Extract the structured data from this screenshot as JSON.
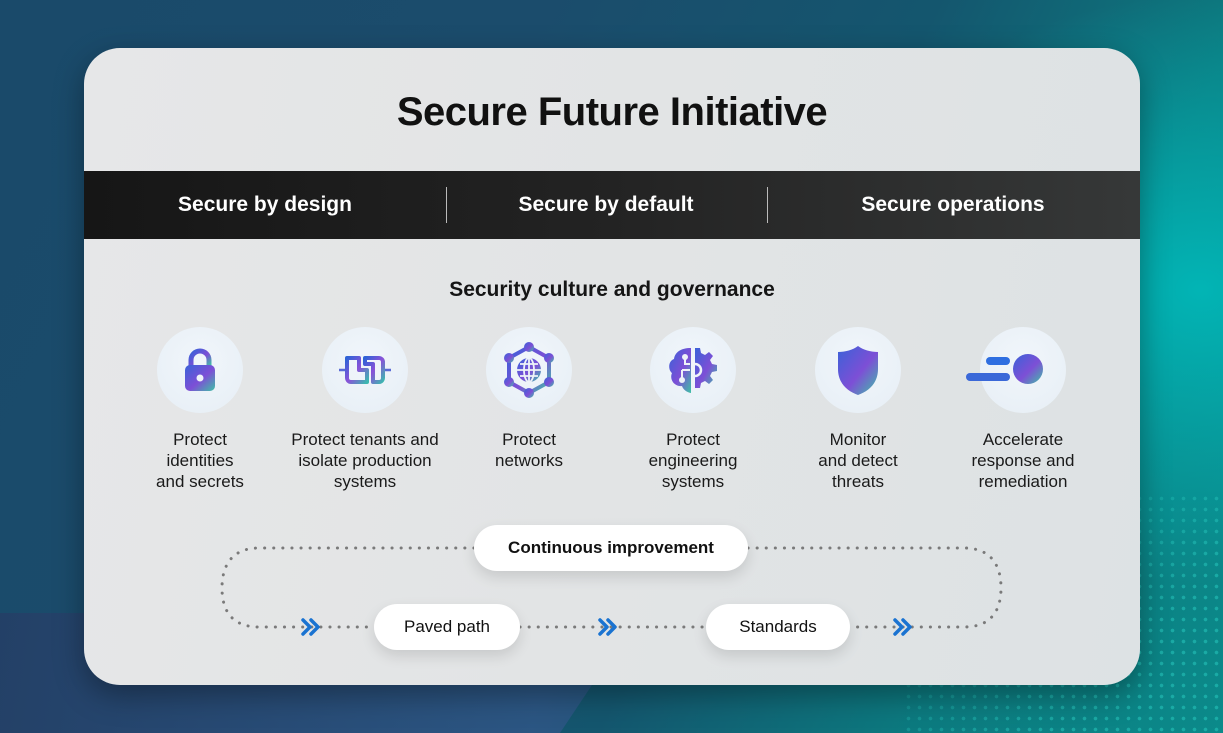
{
  "title": "Secure Future Initiative",
  "pillars": [
    {
      "label": "Secure by design"
    },
    {
      "label": "Secure by default"
    },
    {
      "label": "Secure operations"
    }
  ],
  "foundation": "Security culture and governance",
  "items": [
    {
      "icon": "lock-icon",
      "label": "Protect\nidentities\nand secrets"
    },
    {
      "icon": "isolation-pipe-icon",
      "label": "Protect tenants and\nisolate production\nsystems"
    },
    {
      "icon": "network-globe-icon",
      "label": "Protect\nnetworks"
    },
    {
      "icon": "brain-gear-icon",
      "label": "Protect\nengineering\nsystems"
    },
    {
      "icon": "shield-icon",
      "label": "Monitor\nand detect\nthreats"
    },
    {
      "icon": "speed-circle-icon",
      "label": "Accelerate\nresponse and\nremediation"
    }
  ],
  "cycle": {
    "top": "Continuous improvement",
    "steps": [
      "Paved path",
      "Standards"
    ]
  },
  "colors": {
    "accent_blue": "#1a73d1",
    "gradient_start": "#3b5fd9",
    "gradient_mid": "#7d4fd6",
    "gradient_end": "#3dbfa8",
    "bar_dark": "#1b1b1b"
  }
}
